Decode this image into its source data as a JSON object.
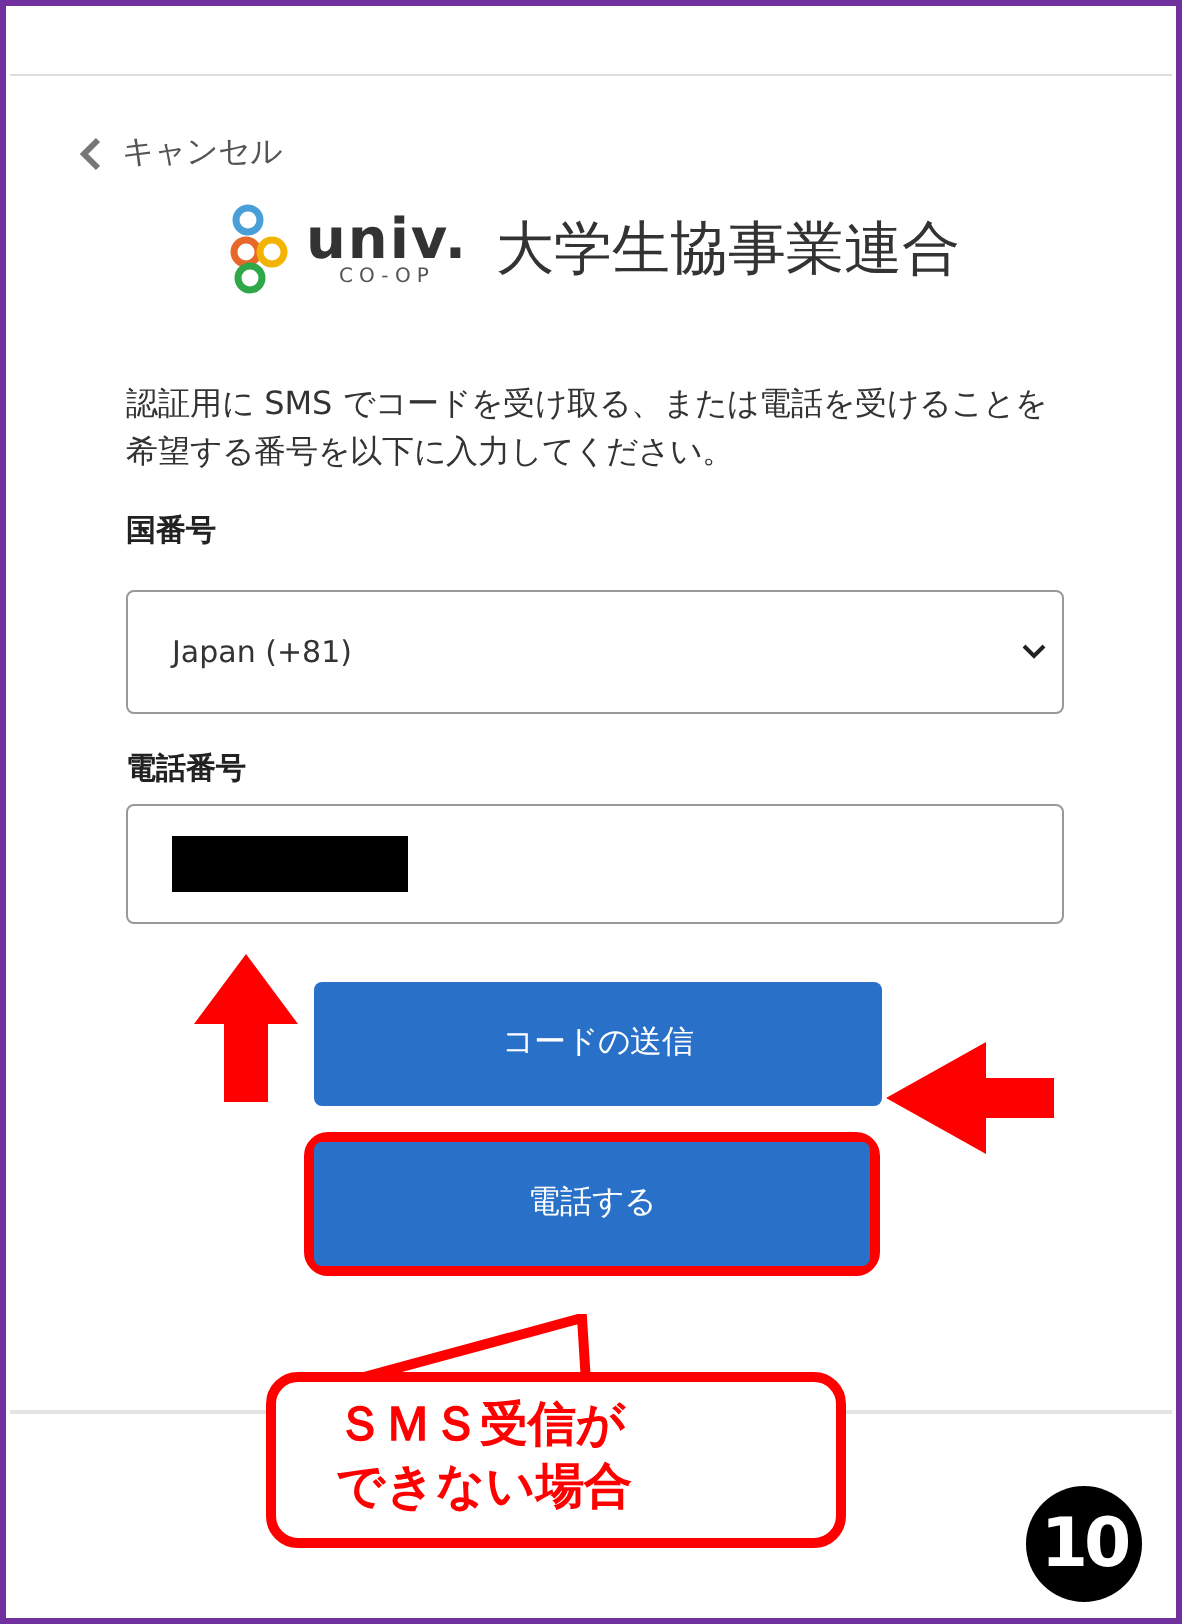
{
  "cancel_link": "キャンセル",
  "logo": {
    "brand": "univ.",
    "sub": "CO-OP",
    "org": "大学生協事業連合"
  },
  "instructions": "認証用に SMS でコードを受け取る、または電話を受けることを希望する番号を以下に入力してください。",
  "country": {
    "label": "国番号",
    "value": "Japan (+81)"
  },
  "phone": {
    "label": "電話番号",
    "redacted": true
  },
  "buttons": [
    {
      "label": "コードの送信",
      "highlighted": false
    },
    {
      "label": "電話する",
      "highlighted": true
    }
  ],
  "callout": [
    "ＳＭＳ受信が",
    "できない場合"
  ],
  "step_badge": "10"
}
